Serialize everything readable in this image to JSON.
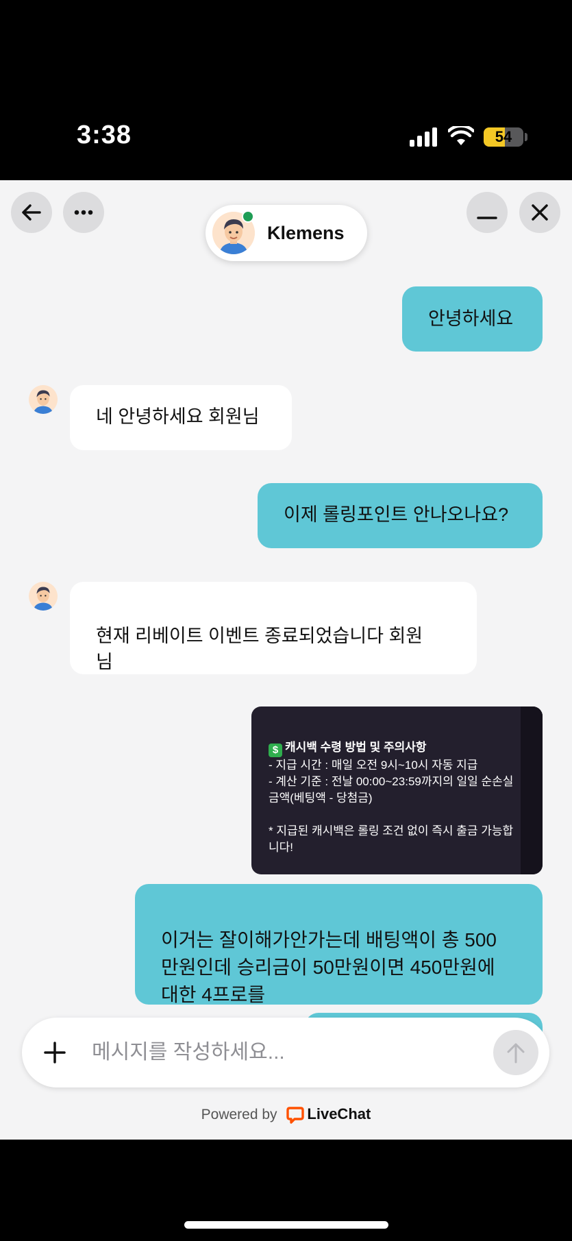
{
  "status_bar": {
    "time": "3:38",
    "battery_level": "54",
    "battery_fraction": 0.54
  },
  "header": {
    "back_icon": "arrow-left-icon",
    "more_icon": "ellipsis-icon",
    "minimize_icon": "minus-icon",
    "close_icon": "x-icon",
    "agent_name": "Klemens",
    "agent_status": "online",
    "online_color": "#1f9d55"
  },
  "messages": [
    {
      "from": "user",
      "text": "안녕하세요"
    },
    {
      "from": "agent",
      "text": "네 안녕하세요 회원님"
    },
    {
      "from": "user",
      "text": "이제 롤링포인트 안나오나요?"
    },
    {
      "from": "agent",
      "text": "현재 리베이트 이벤트 종료되었습니다 회원\n님"
    },
    {
      "from": "user",
      "type": "image",
      "image_title": "캐시백 수령 방법 및 주의사항",
      "image_body": "- 지급 시간 : 매일 오전 9시~10시 자동 지급\n- 계산 기준 : 전날 00:00~23:59까지의 일일 순손실 금액(베팅액 - 당첨금)\n\n* 지급된 캐시백은 롤링 조건 없이 즉시 출금 가능합니다!",
      "image_icon": "dollar-sign-icon"
    },
    {
      "from": "user",
      "text": "이거는 잘이해가안가는데 배팅액이 총 500\n만원인데 승리금이 50만원이면 450만원에\n대한 4프로를"
    }
  ],
  "composer": {
    "placeholder": "메시지를 작성하세요...",
    "attach_icon": "plus-icon",
    "send_icon": "arrow-up-icon"
  },
  "footer": {
    "powered_by": "Powered by",
    "brand": "LiveChat",
    "brand_color": "#ff5100"
  },
  "colors": {
    "user_bubble": "#5fc7d6",
    "agent_bubble": "#ffffff",
    "chat_background": "#f4f4f5"
  }
}
